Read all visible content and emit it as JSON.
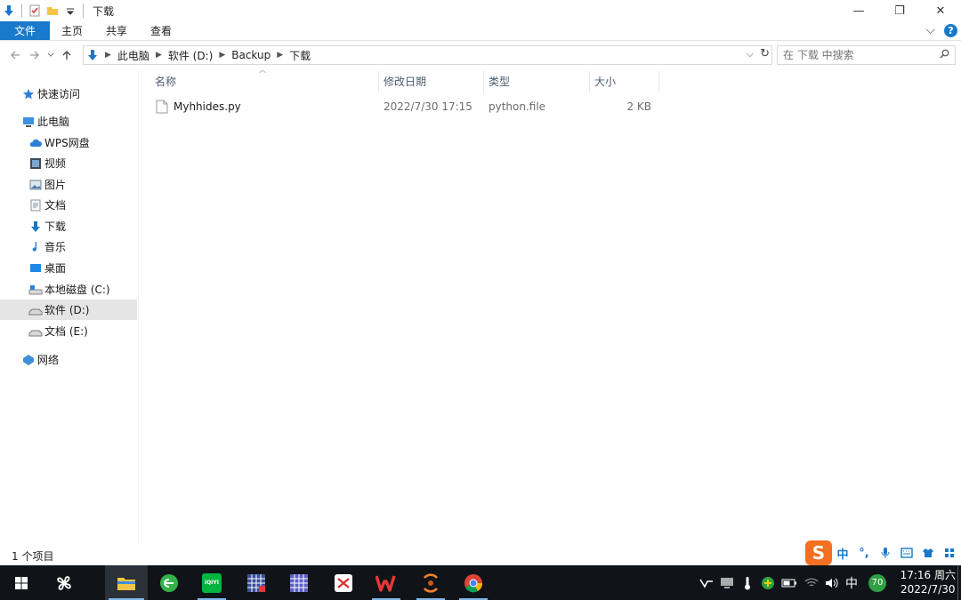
{
  "window": {
    "title": "下载",
    "minimize_glyph": "—",
    "restore_glyph": "❐",
    "close_glyph": "✕"
  },
  "ribbon": {
    "tabs": [
      "文件",
      "主页",
      "共享",
      "查看"
    ],
    "help_glyph": "?",
    "expand_glyph": "⌵"
  },
  "address": {
    "crumbs": [
      "此电脑",
      "软件 (D:)",
      "Backup",
      "下载"
    ],
    "search_placeholder": "在 下载 中搜索"
  },
  "navpane": {
    "items": [
      {
        "label": "快速访问",
        "icon": "star-pin-icon"
      },
      {
        "label": "此电脑",
        "icon": "computer-icon"
      },
      {
        "label": "WPS网盘",
        "icon": "cloud-icon"
      },
      {
        "label": "视频",
        "icon": "video-icon"
      },
      {
        "label": "图片",
        "icon": "pictures-icon"
      },
      {
        "label": "文档",
        "icon": "documents-icon"
      },
      {
        "label": "下载",
        "icon": "download-icon"
      },
      {
        "label": "音乐",
        "icon": "music-icon"
      },
      {
        "label": "桌面",
        "icon": "desktop-icon"
      },
      {
        "label": "本地磁盘 (C:)",
        "icon": "drive-c-icon"
      },
      {
        "label": "软件 (D:)",
        "icon": "drive-icon",
        "selected": true
      },
      {
        "label": "文档 (E:)",
        "icon": "drive-icon"
      },
      {
        "label": "网络",
        "icon": "network-icon"
      }
    ]
  },
  "filelist": {
    "columns": [
      "名称",
      "修改日期",
      "类型",
      "大小"
    ],
    "rows": [
      {
        "name": "Myhhides.py",
        "modified": "2022/7/30 17:15",
        "type": "python.file",
        "size": "2 KB"
      }
    ]
  },
  "statusbar": {
    "item_count": "1 个项目"
  },
  "ime": {
    "mode": "中",
    "punct": "°,"
  },
  "taskbar": {
    "tray_lang": "中",
    "tray_badge": "70",
    "clock_time": "17:16 周六",
    "clock_date": "2022/7/30",
    "iqiyi_label": "iQIYI"
  },
  "colors": {
    "accent": "#1979ca",
    "taskbar": "#101418",
    "sogou": "#f36f21"
  }
}
